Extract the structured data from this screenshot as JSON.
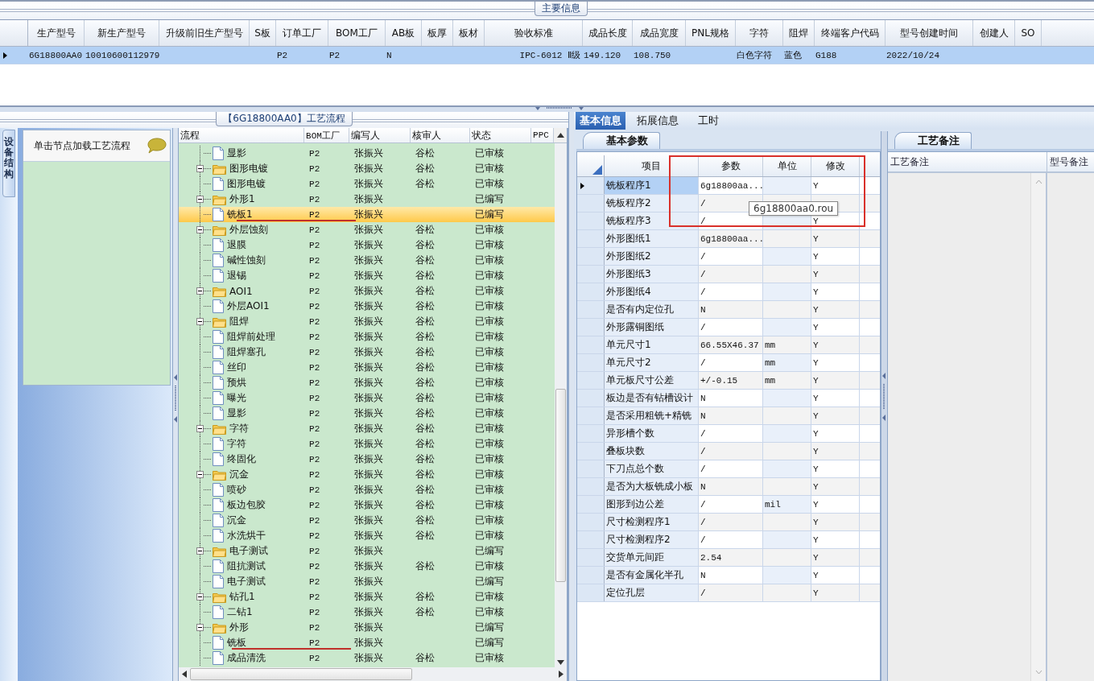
{
  "main_info": {
    "title": "主要信息",
    "row_selected": true,
    "columns": [
      {
        "label": "生产型号",
        "value": "6G18800AA0"
      },
      {
        "label": "新生产型号",
        "value": "10010600112979"
      },
      {
        "label": "升级前旧生产型号"
      },
      {
        "label": "S板"
      },
      {
        "label": "订单工厂",
        "value": "P2"
      },
      {
        "label": "BOM工厂",
        "value": "P2"
      },
      {
        "label": "AB板",
        "value": "N"
      },
      {
        "label": "板厚"
      },
      {
        "label": "板材"
      },
      {
        "label": "验收标准",
        "value": "IPC-6012 Ⅱ级"
      },
      {
        "label": "成品长度",
        "value": "149.120"
      },
      {
        "label": "成品宽度",
        "value": "108.750"
      },
      {
        "label": "PNL规格"
      },
      {
        "label": "字符",
        "value": "白色字符"
      },
      {
        "label": "阻焊",
        "value": "蓝色"
      },
      {
        "label": "终端客户代码",
        "value": "G188"
      },
      {
        "label": "型号创建时间",
        "value": "2022/10/24"
      },
      {
        "label": "创建人"
      },
      {
        "label": "SO"
      }
    ]
  },
  "flow": {
    "title": "【6G18800AA0】工艺流程",
    "side_tab": "设备结构",
    "hint": "单击节点加载工艺流程",
    "columns": [
      "流程",
      "BOM工厂",
      "编写人",
      "核审人",
      "状态",
      "PPC"
    ],
    "tree": [
      {
        "children": [
          {
            "name": "显影",
            "bom": "P2",
            "writer": "张振兴",
            "reviewer": "谷松",
            "status": "已审核",
            "selected": false,
            "marked": false
          }
        ]
      },
      {
        "name": "图形电镀",
        "bom": "P2",
        "writer": "张振兴",
        "reviewer": "谷松",
        "status": "已审核",
        "selected": false,
        "children": [
          {
            "name": "图形电镀",
            "bom": "P2",
            "writer": "张振兴",
            "reviewer": "谷松",
            "status": "已审核",
            "selected": false,
            "marked": false
          }
        ]
      },
      {
        "name": "外形1",
        "bom": "P2",
        "writer": "张振兴",
        "status": "已编写",
        "selected": false,
        "children": [
          {
            "name": "铣板1",
            "bom": "P2",
            "writer": "张振兴",
            "status": "已编写",
            "selected": true,
            "marked": true
          }
        ]
      },
      {
        "name": "外层蚀刻",
        "bom": "P2",
        "writer": "张振兴",
        "reviewer": "谷松",
        "status": "已审核",
        "selected": false,
        "children": [
          {
            "name": "退膜",
            "bom": "P2",
            "writer": "张振兴",
            "reviewer": "谷松",
            "status": "已审核",
            "selected": false,
            "marked": false
          },
          {
            "name": "碱性蚀刻",
            "bom": "P2",
            "writer": "张振兴",
            "reviewer": "谷松",
            "status": "已审核",
            "selected": false,
            "marked": false
          },
          {
            "name": "退锡",
            "bom": "P2",
            "writer": "张振兴",
            "reviewer": "谷松",
            "status": "已审核",
            "selected": false,
            "marked": false
          }
        ]
      },
      {
        "name": "AOI1",
        "bom": "P2",
        "writer": "张振兴",
        "reviewer": "谷松",
        "status": "已审核",
        "selected": false,
        "children": [
          {
            "name": "外层AOI1",
            "bom": "P2",
            "writer": "张振兴",
            "reviewer": "谷松",
            "status": "已审核",
            "selected": false,
            "marked": false
          }
        ]
      },
      {
        "name": "阻焊",
        "bom": "P2",
        "writer": "张振兴",
        "reviewer": "谷松",
        "status": "已审核",
        "selected": false,
        "children": [
          {
            "name": "阻焊前处理",
            "bom": "P2",
            "writer": "张振兴",
            "reviewer": "谷松",
            "status": "已审核",
            "selected": false,
            "marked": false
          },
          {
            "name": "阻焊塞孔",
            "bom": "P2",
            "writer": "张振兴",
            "reviewer": "谷松",
            "status": "已审核",
            "selected": false,
            "marked": false
          },
          {
            "name": "丝印",
            "bom": "P2",
            "writer": "张振兴",
            "reviewer": "谷松",
            "status": "已审核",
            "selected": false,
            "marked": false
          },
          {
            "name": "预烘",
            "bom": "P2",
            "writer": "张振兴",
            "reviewer": "谷松",
            "status": "已审核",
            "selected": false,
            "marked": false
          },
          {
            "name": "曝光",
            "bom": "P2",
            "writer": "张振兴",
            "reviewer": "谷松",
            "status": "已审核",
            "selected": false,
            "marked": false
          },
          {
            "name": "显影",
            "bom": "P2",
            "writer": "张振兴",
            "reviewer": "谷松",
            "status": "已审核",
            "selected": false,
            "marked": false
          }
        ]
      },
      {
        "name": "字符",
        "bom": "P2",
        "writer": "张振兴",
        "reviewer": "谷松",
        "status": "已审核",
        "selected": false,
        "children": [
          {
            "name": "字符",
            "bom": "P2",
            "writer": "张振兴",
            "reviewer": "谷松",
            "status": "已审核",
            "selected": false,
            "marked": false
          },
          {
            "name": "终固化",
            "bom": "P2",
            "writer": "张振兴",
            "reviewer": "谷松",
            "status": "已审核",
            "selected": false,
            "marked": false
          }
        ]
      },
      {
        "name": "沉金",
        "bom": "P2",
        "writer": "张振兴",
        "reviewer": "谷松",
        "status": "已审核",
        "selected": false,
        "children": [
          {
            "name": "喷砂",
            "bom": "P2",
            "writer": "张振兴",
            "reviewer": "谷松",
            "status": "已审核",
            "selected": false,
            "marked": false
          },
          {
            "name": "板边包胶",
            "bom": "P2",
            "writer": "张振兴",
            "reviewer": "谷松",
            "status": "已审核",
            "selected": false,
            "marked": false
          },
          {
            "name": "沉金",
            "bom": "P2",
            "writer": "张振兴",
            "reviewer": "谷松",
            "status": "已审核",
            "selected": false,
            "marked": false
          },
          {
            "name": "水洗烘干",
            "bom": "P2",
            "writer": "张振兴",
            "reviewer": "谷松",
            "status": "已审核",
            "selected": false,
            "marked": false
          }
        ]
      },
      {
        "name": "电子测试",
        "bom": "P2",
        "writer": "张振兴",
        "status": "已编写",
        "selected": false,
        "children": [
          {
            "name": "阻抗测试",
            "bom": "P2",
            "writer": "张振兴",
            "reviewer": "谷松",
            "status": "已审核",
            "selected": false,
            "marked": false
          },
          {
            "name": "电子测试",
            "bom": "P2",
            "writer": "张振兴",
            "status": "已编写",
            "selected": false,
            "marked": false
          }
        ]
      },
      {
        "name": "钻孔1",
        "bom": "P2",
        "writer": "张振兴",
        "reviewer": "谷松",
        "status": "已审核",
        "selected": false,
        "children": [
          {
            "name": "二钻1",
            "bom": "P2",
            "writer": "张振兴",
            "reviewer": "谷松",
            "status": "已审核",
            "selected": false,
            "marked": false
          }
        ]
      },
      {
        "name": "外形",
        "bom": "P2",
        "writer": "张振兴",
        "status": "已编写",
        "selected": false,
        "children": [
          {
            "name": "铣板",
            "bom": "P2",
            "writer": "张振兴",
            "status": "已编写",
            "selected": false,
            "marked": true
          },
          {
            "name": "成品清洗",
            "bom": "P2",
            "writer": "张振兴",
            "reviewer": "谷松",
            "status": "已审核",
            "selected": false,
            "marked": false
          }
        ]
      }
    ]
  },
  "detail": {
    "tabs": [
      {
        "label": "基本信息",
        "selected": true
      },
      {
        "label": "拓展信息",
        "selected": false
      },
      {
        "label": "工时",
        "selected": false
      }
    ],
    "params": {
      "tab": "基本参数",
      "columns": [
        "项目",
        "参数",
        "单位",
        "修改"
      ],
      "tooltip": "6g18800aa0.rou",
      "rows": [
        {
          "item": "铣板程序1",
          "value": "6g18800aa...",
          "edit": "Y",
          "selected": true
        },
        {
          "item": "铣板程序2",
          "value": "/",
          "selected": false
        },
        {
          "item": "铣板程序3",
          "value": "/",
          "edit": "Y",
          "selected": false
        },
        {
          "item": "外形图纸1",
          "value": "6g18800aa...",
          "edit": "Y",
          "selected": false
        },
        {
          "item": "外形图纸2",
          "value": "/",
          "edit": "Y",
          "selected": false
        },
        {
          "item": "外形图纸3",
          "value": "/",
          "edit": "Y",
          "selected": false
        },
        {
          "item": "外形图纸4",
          "value": "/",
          "edit": "Y",
          "selected": false
        },
        {
          "item": "是否有内定位孔",
          "value": "N",
          "edit": "Y",
          "selected": false
        },
        {
          "item": "外形露铜图纸",
          "value": "/",
          "edit": "Y",
          "selected": false
        },
        {
          "item": "单元尺寸1",
          "value": "66.55X46.37",
          "unit": "mm",
          "edit": "Y",
          "selected": false
        },
        {
          "item": "单元尺寸2",
          "value": "/",
          "unit": "mm",
          "edit": "Y",
          "selected": false
        },
        {
          "item": "单元板尺寸公差",
          "value": "+/-0.15",
          "unit": "mm",
          "edit": "Y",
          "selected": false
        },
        {
          "item": "板边是否有钻槽设计",
          "value": "N",
          "edit": "Y",
          "selected": false
        },
        {
          "item": "是否采用粗铣+精铣",
          "value": "N",
          "edit": "Y",
          "selected": false
        },
        {
          "item": "异形槽个数",
          "value": "/",
          "edit": "Y",
          "selected": false
        },
        {
          "item": "叠板块数",
          "value": "/",
          "edit": "Y",
          "selected": false
        },
        {
          "item": "下刀点总个数",
          "value": "/",
          "edit": "Y",
          "selected": false
        },
        {
          "item": "是否为大板铣成小板",
          "value": "N",
          "edit": "Y",
          "selected": false
        },
        {
          "item": "图形到边公差",
          "value": "/",
          "unit": "mil",
          "edit": "Y",
          "selected": false
        },
        {
          "item": "尺寸检测程序1",
          "value": "/",
          "edit": "Y",
          "selected": false
        },
        {
          "item": "尺寸检测程序2",
          "value": "/",
          "edit": "Y",
          "selected": false
        },
        {
          "item": "交货单元间距",
          "value": "2.54",
          "edit": "Y",
          "selected": false
        },
        {
          "item": "是否有金属化半孔",
          "value": "N",
          "edit": "Y",
          "selected": false
        },
        {
          "item": "定位孔层",
          "value": "/",
          "edit": "Y",
          "selected": false
        }
      ]
    },
    "notes": {
      "tab": "工艺备注",
      "columns": [
        "工艺备注",
        "型号备注"
      ]
    }
  }
}
